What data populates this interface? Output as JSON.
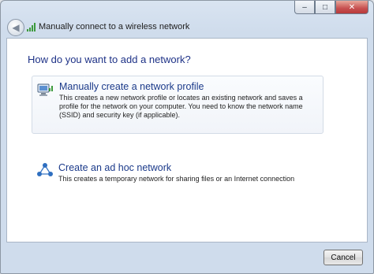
{
  "window": {
    "title": "Manually connect to a wireless network",
    "controls": {
      "minimize": "–",
      "maximize": "□",
      "close": "✕"
    },
    "back_glyph": "◀"
  },
  "main": {
    "heading": "How do you want to add a network?",
    "options": [
      {
        "title": "Manually create a network profile",
        "description": "This creates a new network profile or locates an existing network and saves a profile for the network on your computer. You need to know the network name (SSID) and security key (if applicable).",
        "icon": "network-profile-icon"
      },
      {
        "title": "Create an ad hoc network",
        "description": "This creates a temporary network for sharing files or an Internet connection",
        "icon": "ad-hoc-network-icon"
      }
    ]
  },
  "footer": {
    "cancel_label": "Cancel"
  },
  "colors": {
    "heading": "#1e3287",
    "option_title": "#1b3a8a",
    "chrome": "#cfdcec",
    "close_button": "#c75050"
  }
}
